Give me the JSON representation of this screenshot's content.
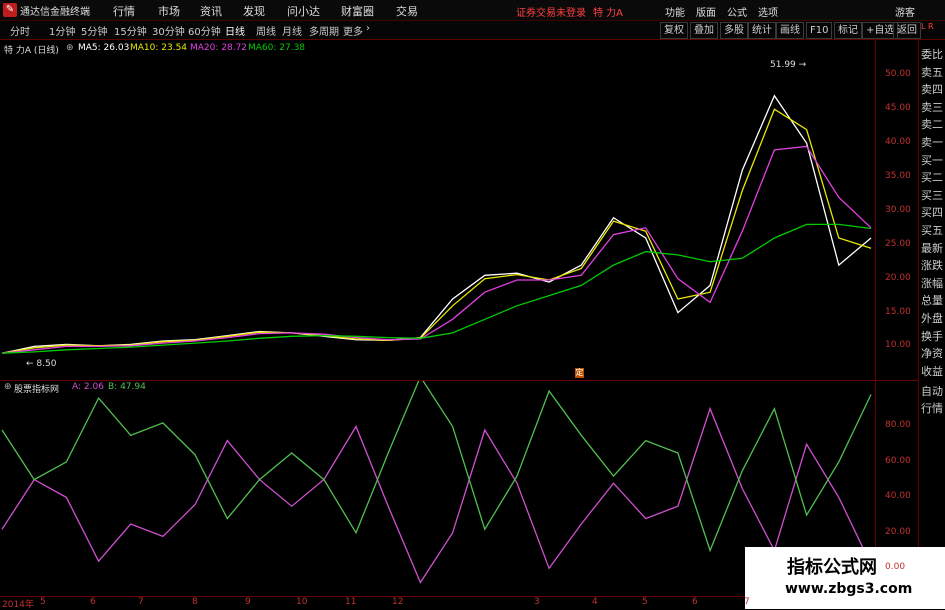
{
  "titlebar": {
    "app_title": "通达信金融终端",
    "menus": [
      "行情",
      "市场",
      "资讯",
      "发现",
      "问小达",
      "财富圈",
      "交易"
    ],
    "login_notice": "证券交易未登录",
    "stock_name": "特 力A",
    "right_menus": [
      "功能",
      "版面",
      "公式",
      "选项"
    ],
    "user": "游客"
  },
  "toolbar": {
    "periods": [
      "分时",
      "1分钟",
      "5分钟",
      "15分钟",
      "30分钟",
      "60分钟",
      "日线",
      "周线",
      "月线",
      "多周期",
      "更多"
    ],
    "active_period": "日线",
    "right_buttons": [
      "复权",
      "叠加",
      "多股",
      "统计",
      "画线",
      "F10",
      "标记",
      "+自选",
      "返回"
    ]
  },
  "main_legend": {
    "title": "特 力A (日线)",
    "ma5": "MA5: 26.03",
    "ma10": "MA10: 23.54",
    "ma20": "MA20: 28.72",
    "ma60": "MA60: 27.38"
  },
  "indicator_legend": {
    "name": "股票指标网",
    "a": "A: 2.06",
    "b": "B: 47.94"
  },
  "annotations": {
    "high": "51.99",
    "low": "8.50"
  },
  "side_panel": [
    "委比",
    "卖五",
    "卖四",
    "卖三",
    "卖二",
    "卖一",
    "买一",
    "买二",
    "买三",
    "买四",
    "买五",
    "最新",
    "涨跌",
    "涨幅",
    "总量",
    "外盘",
    "换手",
    "净资",
    "收益",
    "自动",
    "行情"
  ],
  "colors": {
    "ma5": "#ffffff",
    "ma10": "#e8e800",
    "ma20": "#e040e0",
    "ma60": "#00cc00",
    "ind_a": "#d050d0",
    "ind_b": "#50c050",
    "axis": "#c23030"
  },
  "chart_data": [
    {
      "type": "line",
      "title": "特 力A (日线)",
      "ylim": [
        8,
        53
      ],
      "y_ticks": [
        "50.00",
        "45.00",
        "40.00",
        "35.00",
        "30.00",
        "25.00",
        "20.00",
        "15.00",
        "10.00"
      ],
      "x_ticks": [
        "2014年",
        "5",
        "6",
        "7",
        "8",
        "9",
        "10",
        "11",
        "12",
        "3",
        "4",
        "5",
        "6",
        "7"
      ],
      "series": [
        {
          "name": "MA5",
          "values": [
            9.0,
            10.0,
            10.3,
            10.1,
            10.3,
            10.8,
            11.0,
            11.6,
            12.2,
            12.0,
            11.5,
            11.0,
            10.9,
            11.3,
            17.0,
            20.5,
            20.8,
            19.5,
            22.0,
            29.0,
            26.0,
            15.0,
            19.0,
            36.0,
            47.0,
            40.0,
            22.0,
            26.0
          ]
        },
        {
          "name": "MA10",
          "values": [
            9.0,
            9.8,
            10.2,
            10.1,
            10.2,
            10.7,
            10.9,
            11.5,
            12.1,
            12.0,
            11.6,
            11.1,
            10.9,
            11.2,
            16.0,
            20.0,
            20.6,
            19.8,
            21.5,
            28.5,
            27.0,
            17.0,
            18.0,
            33.0,
            45.0,
            42.0,
            26.0,
            24.5
          ]
        },
        {
          "name": "MA20",
          "values": [
            9.0,
            9.5,
            10.0,
            10.0,
            10.1,
            10.5,
            10.8,
            11.3,
            11.9,
            12.0,
            11.8,
            11.3,
            11.0,
            11.1,
            14.0,
            18.0,
            19.8,
            19.8,
            20.5,
            26.5,
            27.5,
            20.0,
            16.5,
            27.0,
            39.0,
            39.5,
            32.0,
            27.5
          ]
        },
        {
          "name": "MA60",
          "values": [
            9.0,
            9.2,
            9.5,
            9.7,
            9.9,
            10.2,
            10.5,
            10.8,
            11.2,
            11.5,
            11.6,
            11.5,
            11.3,
            11.2,
            12.0,
            14.0,
            16.0,
            17.5,
            19.0,
            22.0,
            24.0,
            23.5,
            22.5,
            23.0,
            26.0,
            28.0,
            28.0,
            27.4
          ]
        }
      ]
    },
    {
      "type": "line",
      "title": "股票指标网",
      "ylim": [
        -10,
        100
      ],
      "y_ticks": [
        "80.00",
        "60.00",
        "40.00",
        "20.00",
        "0.00"
      ],
      "series": [
        {
          "name": "A",
          "values": [
            22,
            50,
            40,
            4,
            25,
            18,
            36,
            72,
            50,
            35,
            50,
            80,
            35,
            -8,
            20,
            78,
            48,
            0,
            25,
            48,
            28,
            35,
            90,
            45,
            10,
            70,
            40,
            2
          ]
        },
        {
          "name": "B",
          "values": [
            78,
            50,
            60,
            96,
            75,
            82,
            64,
            28,
            50,
            65,
            50,
            20,
            65,
            108,
            80,
            22,
            52,
            100,
            75,
            52,
            72,
            65,
            10,
            55,
            90,
            30,
            60,
            98
          ]
        }
      ]
    }
  ]
}
